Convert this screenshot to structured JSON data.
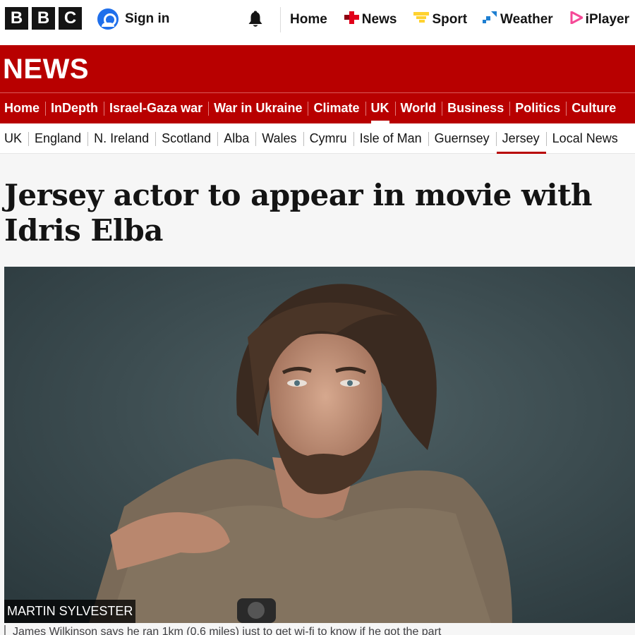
{
  "brand": {
    "letters": [
      "B",
      "B",
      "C"
    ]
  },
  "account": {
    "signin_label": "Sign in"
  },
  "topnav": {
    "items": [
      {
        "label": "Home",
        "icon": "none"
      },
      {
        "label": "News",
        "icon": "news-icon",
        "color": "#e1001a"
      },
      {
        "label": "Sport",
        "icon": "sport-icon",
        "color": "#ffd230"
      },
      {
        "label": "Weather",
        "icon": "weather-icon",
        "color": "#1e7fd1"
      },
      {
        "label": "iPlayer",
        "icon": "iplayer-icon",
        "color": "#f54997"
      }
    ]
  },
  "section": {
    "title": "NEWS",
    "color": "#b80000"
  },
  "mainnav": {
    "items": [
      "Home",
      "InDepth",
      "Israel-Gaza war",
      "War in Ukraine",
      "Climate",
      "UK",
      "World",
      "Business",
      "Politics",
      "Culture"
    ],
    "active": "UK"
  },
  "subnav": {
    "items": [
      "UK",
      "England",
      "N. Ireland",
      "Scotland",
      "Alba",
      "Wales",
      "Cymru",
      "Isle of Man",
      "Guernsey",
      "Jersey",
      "Local News"
    ],
    "active": "Jersey"
  },
  "article": {
    "headline": "Jersey actor to appear in movie with Idris Elba",
    "image_credit": "MARTIN SYLVESTER",
    "caption": "James Wilkinson says he ran 1km (0.6 miles) just to get wi-fi to know if he got the part"
  }
}
